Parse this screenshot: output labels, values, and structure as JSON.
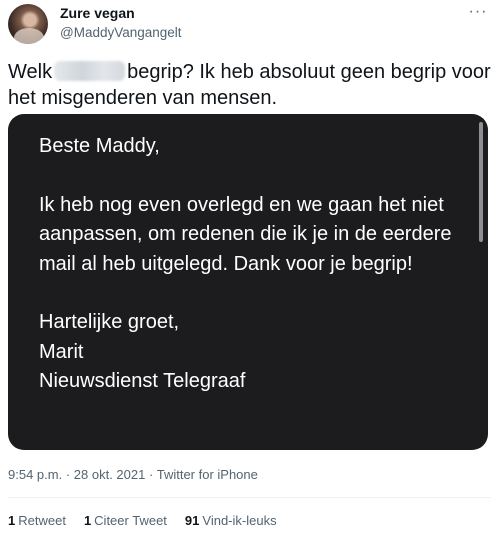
{
  "author": {
    "name": "Zure vegan",
    "handle": "@MaddyVangangelt"
  },
  "tweet": {
    "text_before": "Welk",
    "text_after": "begrip? Ik heb absoluut geen begrip voor het misgenderen van mensen."
  },
  "media": {
    "email_text": "Beste Maddy,\n\nIk heb nog even overlegd en we gaan het niet aanpassen, om redenen die ik je in de eerdere mail al heb uitgelegd. Dank voor je begrip!\n\nHartelijke groet,\nMarit\nNieuwsdienst Telegraaf"
  },
  "meta": {
    "time": "9:54 p.m.",
    "date": "28 okt. 2021",
    "source": "Twitter for iPhone",
    "separator": "·"
  },
  "stats": [
    {
      "count": "1",
      "label": "Retweet"
    },
    {
      "count": "1",
      "label": "Citeer Tweet"
    },
    {
      "count": "91",
      "label": "Vind-ik-leuks"
    }
  ],
  "icons": {
    "more": "more-horizontal-icon"
  }
}
